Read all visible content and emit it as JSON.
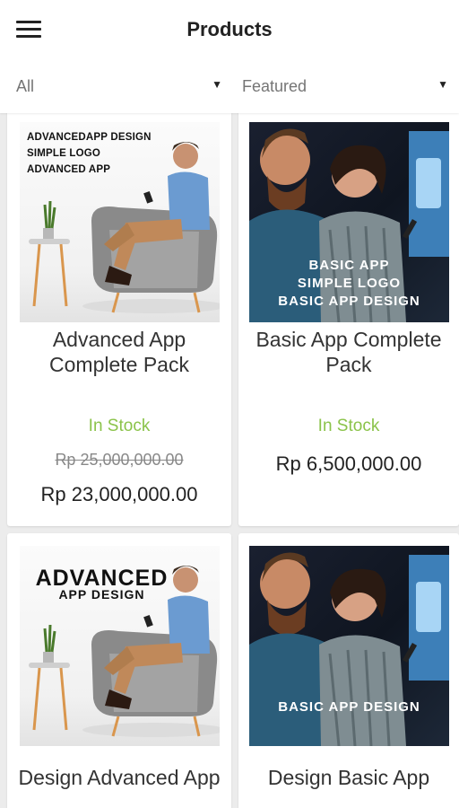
{
  "header": {
    "title": "Products"
  },
  "filters": {
    "category": {
      "value": "All"
    },
    "sort": {
      "value": "Featured"
    }
  },
  "products": [
    {
      "name": "Advanced App Complete Pack",
      "stock": "In Stock",
      "old_price": "Rp 25,000,000.00",
      "price": "Rp 23,000,000.00",
      "image_lines": [
        "ADVANCEDAPP DESIGN",
        "SIMPLE LOGO",
        "ADVANCED APP"
      ]
    },
    {
      "name": "Basic App Complete Pack",
      "stock": "In Stock",
      "price": "Rp 6,500,000.00",
      "image_lines": [
        "BASIC APP",
        "SIMPLE LOGO",
        "BASIC APP DESIGN"
      ]
    },
    {
      "name": "Design Advanced App",
      "image_lines": [
        "ADVANCED",
        "APP DESIGN"
      ]
    },
    {
      "name": "Design Basic App",
      "image_lines": [
        "BASIC APP DESIGN"
      ]
    }
  ]
}
